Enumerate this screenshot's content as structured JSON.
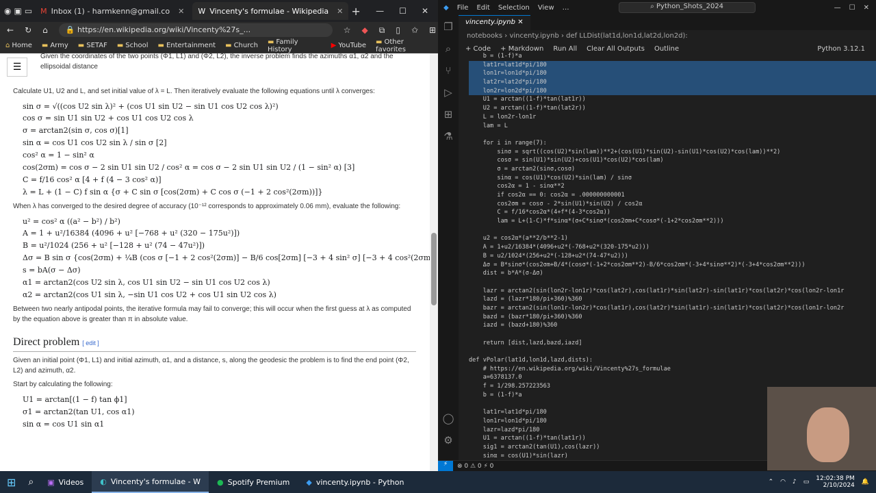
{
  "browser": {
    "tabs": [
      {
        "label": "Inbox (1) - harmkenn@gmail.co"
      },
      {
        "label": "Vincenty's formulae - Wikipedia"
      }
    ],
    "url": "https://en.wikipedia.org/wiki/Vincenty%27s_...",
    "bookmarks": [
      "Home",
      "Army",
      "SETAF",
      "School",
      "Entertainment",
      "Church",
      "Family History",
      "YouTube",
      "Other favorites"
    ]
  },
  "wiki": {
    "intro": "Given the coordinates of the two points (Φ1, L1) and (Φ2, L2), the inverse problem finds the azimuths α1, α2 and the ellipsoidal distance",
    "calc": "Calculate U1, U2 and L, and set initial value of λ = L. Then iteratively evaluate the following equations until λ converges:",
    "eq1": [
      "sin σ = √((cos U2 sin λ)² + (cos U1 sin U2 − sin U1 cos U2 cos λ)²)",
      "cos σ = sin U1 sin U2 + cos U1 cos U2 cos λ",
      "σ = arctan2(sin σ, cos σ)[1]",
      "sin α = cos U1 cos U2 sin λ / sin σ [2]",
      "cos² α = 1 − sin² α",
      "cos(2σm) = cos σ − 2 sin U1 sin U2 / cos² α = cos σ − 2 sin U1 sin U2 / (1 − sin² α) [3]",
      "C = f/16 cos² α [4 + f (4 − 3 cos² α)]",
      "λ = L + (1 − C) f sin α {σ + C sin σ [cos(2σm) + C cos σ (−1 + 2 cos²(2σm))]}"
    ],
    "converged": "When λ has converged to the desired degree of accuracy (10⁻¹² corresponds to approximately 0.06 mm), evaluate the following:",
    "eq2": [
      "u² = cos² α ((a² − b²) / b²)",
      "A = 1 + u²/16384 (4096 + u² [−768 + u² (320 − 175u²)])",
      "B = u²/1024 (256 + u² [−128 + u² (74 − 47u²)])",
      "Δσ = B sin σ {cos(2σm) + ¼B (cos σ [−1 + 2 cos²(2σm)] − B/6 cos[2σm] [−3 + 4 sin² σ] [−3 + 4 cos²(2σm)])}",
      "s = bA(σ − Δσ)",
      "α1 = arctan2(cos U2 sin λ, cos U1 sin U2 − sin U1 cos U2 cos λ)",
      "α2 = arctan2(cos U1 sin λ, −sin U1 cos U2 + cos U1 sin U2 cos λ)"
    ],
    "antipodal": "Between two nearly antipodal points, the iterative formula may fail to converge; this will occur when the first guess at λ as computed by the equation above is greater than π in absolute value.",
    "direct_title": "Direct problem",
    "edit": "[ edit ]",
    "direct_text": "Given an initial point (Φ1, L1) and initial azimuth, α1, and a distance, s, along the geodesic the problem is to find the end point (Φ2, L2) and azimuth, α2.",
    "start": "Start by calculating the following:",
    "eq3": [
      "U1 = arctan[(1 − f) tan ϕ1]",
      "σ1 = arctan2(tan U1, cos α1)",
      "sin α = cos U1 sin α1"
    ]
  },
  "vscode": {
    "search": "Python_Shots_2024",
    "menu": [
      "File",
      "Edit",
      "Selection",
      "View"
    ],
    "tab": "vincenty.ipynb",
    "breadcrumb": "notebooks › vincenty.ipynb › def LLDist(lat1d,lon1d,lat2d,lon2d):",
    "toolbar": [
      "+ Code",
      "+ Markdown",
      "Run All",
      "Clear All Outputs",
      "Outline",
      "Python 3.12.1"
    ],
    "code": [
      "    b = (1-f)*a",
      "    lat1r=lat1d*pi/180",
      "    lon1r=lon1d*pi/180",
      "    lat2r=lat2d*pi/180",
      "    lon2r=lon2d*pi/180",
      "    U1 = arctan((1-f)*tan(lat1r))",
      "    U2 = arctan((1-f)*tan(lat2r))",
      "    L = lon2r-lon1r",
      "    lam = L",
      "",
      "    for i in range(7):",
      "        sinσ = sqrt((cos(U2)*sin(lam))**2+(cos(U1)*sin(U2)-sin(U1)*cos(U2)*cos(lam))**2)",
      "        cosσ = sin(U1)*sin(U2)+cos(U1)*cos(U2)*cos(lam)",
      "        σ = arctan2(sinσ,cosσ)",
      "        sinα = cos(U1)*cos(U2)*sin(lam) / sinσ",
      "        cos2α = 1 - sinα**2",
      "        if cos2α == 0: cos2α = .000000000001",
      "        cos2σm = cosσ - 2*sin(U1)*sin(U2) / cos2α",
      "        C = f/16*cos2α*(4+f*(4-3*cos2α))",
      "        lam = L+(1-C)*f*sinα*(σ+C*sinσ*(cos2σm+C*cosσ*(-1+2*cos2σm**2)))",
      "",
      "    u2 = cos2α*(a**2/b**2-1)",
      "    A = 1+u2/16384*(4096+u2*(-768+u2*(320-175*u2)))",
      "    B = u2/1024*(256+u2*(-128+u2*(74-47*u2)))",
      "    Δσ = B*sinσ*(cos2σm+B/4*(cosσ*(-1+2*cos2σm**2)-B/6*cos2σm*(-3+4*sinσ**2)*(-3+4*cos2σm**2)))",
      "    dist = b*A*(σ-Δσ)",
      "",
      "    lazr = arctan2(sin(lon2r-lon1r)*cos(lat2r),cos(lat1r)*sin(lat2r)-sin(lat1r)*cos(lat2r)*cos(lon2r-lon1r",
      "    lazd = (lazr*180/pi+360)%360",
      "    bazr = arctan2(sin(lon1r-lon2r)*cos(lat1r),cos(lat2r)*sin(lat1r)-sin(lat1r)*cos(lat2r)*cos(lon1r-lon2r",
      "    bazd = (bazr*180/pi+360)%360",
      "    iazd = (bazd+180)%360",
      "",
      "    return [dist,lazd,bazd,iazd]",
      "",
      "def vPolar(lat1d,lon1d,lazd,dists):",
      "    # https://en.wikipedia.org/wiki/Vincenty%27s_formulae",
      "    a=6378137.0",
      "    f = 1/298.257223563",
      "    b = (1-f)*a",
      "",
      "    lat1r=lat1d*pi/180",
      "    lon1r=lon1d*pi/180",
      "    lazr=lazd*pi/180",
      "    U1 = arctan((1-f)*tan(lat1r))",
      "    sig1 = arctan2(tan(U1),cos(lazr))",
      "    sinα = cos(U1)*sin(lazr)"
    ],
    "status": "⊗ 0 ⚠ 0  ⚡ 0"
  },
  "taskbar": {
    "items": [
      "Videos",
      "Vincenty's formulae - W",
      "Spotify Premium",
      "vincenty.ipynb - Python"
    ],
    "time": "12:02:38 PM",
    "date": "2/10/2024"
  }
}
